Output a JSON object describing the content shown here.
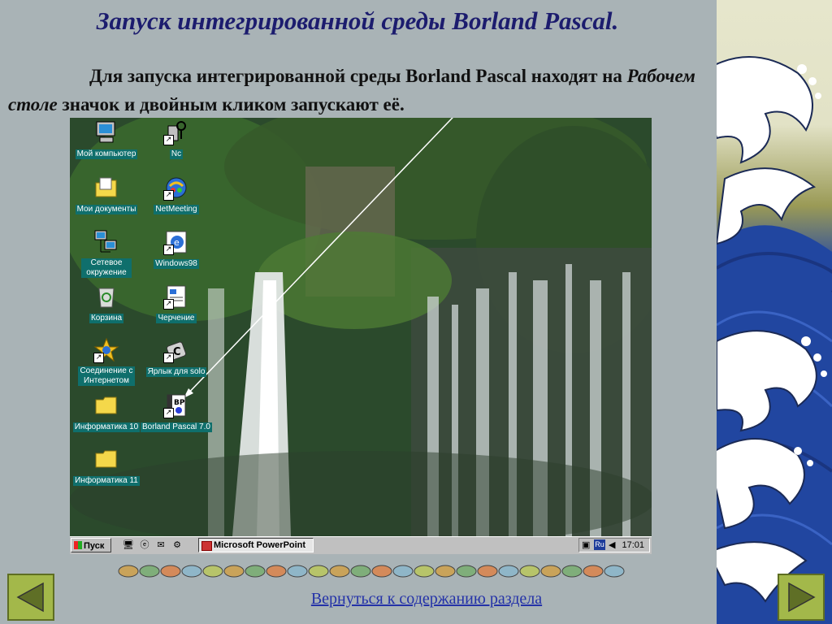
{
  "slide": {
    "title": "Запуск интегрированной среды Borland Pascal.",
    "paragraph": {
      "part1": "Для запуска интегрированной среды Borland Pascal находят на ",
      "emphasis": "Рабочем столе",
      "part2": " значок и двойным кликом запускают её."
    },
    "back_link": "Вернуться к содержанию раздела"
  },
  "desktop": {
    "icons": [
      {
        "name": "my-computer",
        "label": "Мой компьютер"
      },
      {
        "name": "nc",
        "label": "Nc"
      },
      {
        "name": "my-documents",
        "label": "Мои документы"
      },
      {
        "name": "netmeeting",
        "label": "NetMeeting"
      },
      {
        "name": "network",
        "label": "Сетевое окружение"
      },
      {
        "name": "windows98",
        "label": "Windows98"
      },
      {
        "name": "recycle-bin",
        "label": "Корзина"
      },
      {
        "name": "cherchenie",
        "label": "Черчение"
      },
      {
        "name": "internet-connection",
        "label": "Соединение с Интернетом"
      },
      {
        "name": "solo-shortcut",
        "label": "Ярлык для solo"
      },
      {
        "name": "informatika10",
        "label": "Информатика 10"
      },
      {
        "name": "borland-pascal",
        "label": "Borland Pascal 7.0"
      },
      {
        "name": "informatika11",
        "label": "Информатика 11"
      }
    ]
  },
  "taskbar": {
    "start_label": "Пуск",
    "active_task": "Microsoft PowerPoint",
    "language": "Ru",
    "clock": "17:01"
  },
  "colors": {
    "title": "#1c1c6e",
    "link": "#2432a8",
    "nav_button": "#a3b84a",
    "desktop_label_bg": "#0f6f6c",
    "slide_bg": "#a9b3b6"
  }
}
